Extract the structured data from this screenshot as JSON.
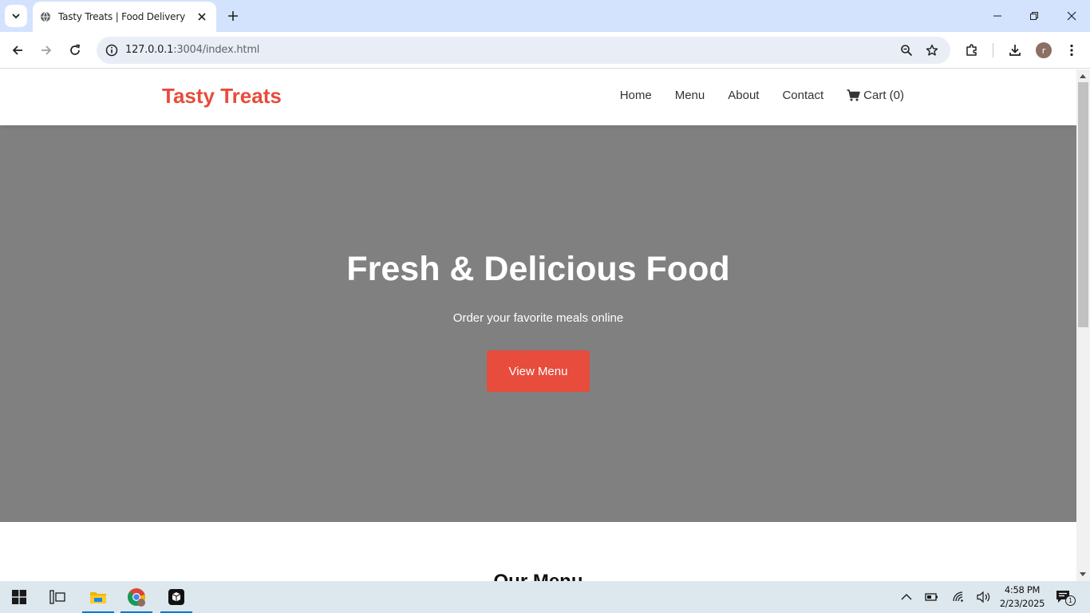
{
  "browser": {
    "tab_title": "Tasty Treats | Food Delivery",
    "url_host": "127.0.0.1",
    "url_rest": ":3004/index.html",
    "profile_initial": "r"
  },
  "site": {
    "logo": "Tasty Treats",
    "nav": [
      {
        "label": "Home"
      },
      {
        "label": "Menu"
      },
      {
        "label": "About"
      },
      {
        "label": "Contact"
      }
    ],
    "cart_label": "Cart (0)",
    "hero": {
      "title": "Fresh & Delicious Food",
      "subtitle": "Order your favorite meals online",
      "button": "View Menu"
    },
    "menu_heading": "Our Menu",
    "colors": {
      "brand": "#e74c3c",
      "hero_bg": "#808080"
    }
  },
  "taskbar": {
    "time": "4:58 PM",
    "date": "2/23/2025",
    "notification_count": "1"
  }
}
